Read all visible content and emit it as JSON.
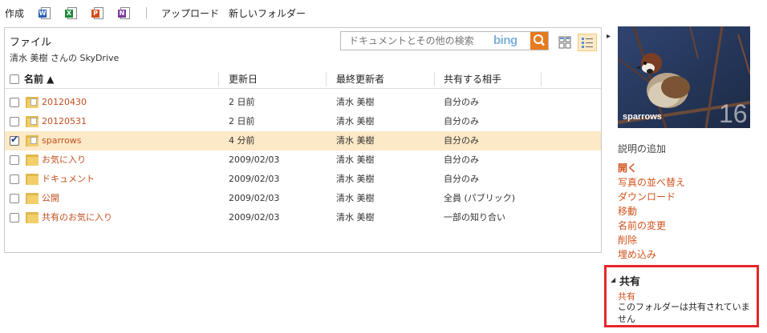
{
  "toolbar": {
    "create_label": "作成",
    "apps": [
      {
        "icon": "word-icon",
        "letter": "W",
        "color": "#2a5fb5"
      },
      {
        "icon": "excel-icon",
        "letter": "X",
        "color": "#1f8a3b"
      },
      {
        "icon": "powerpoint-icon",
        "letter": "P",
        "color": "#d24d1f"
      },
      {
        "icon": "onenote-icon",
        "letter": "N",
        "color": "#7a3a9a"
      }
    ],
    "upload_label": "アップロード",
    "new_folder_label": "新しいフォルダー"
  },
  "panel": {
    "title": "ファイル",
    "subtitle": "清水 美樹 さんの SkyDrive",
    "search_placeholder": "ドキュメントとその他の検索",
    "search_brand": "bing"
  },
  "columns": {
    "name": "名前 ▲",
    "modified": "更新日",
    "modified_by": "最終更新者",
    "shared_with": "共有する相手"
  },
  "rows": [
    {
      "name": "20120430",
      "modified": "2 日前",
      "by": "清水 美樹",
      "shared": "自分のみ",
      "checked": false,
      "type": "photo-folder"
    },
    {
      "name": "20120531",
      "modified": "2 日前",
      "by": "清水 美樹",
      "shared": "自分のみ",
      "checked": false,
      "type": "photo-folder"
    },
    {
      "name": "sparrows",
      "modified": "4 分前",
      "by": "清水 美樹",
      "shared": "自分のみ",
      "checked": true,
      "type": "photo-folder"
    },
    {
      "name": "お気に入り",
      "modified": "2009/02/03",
      "by": "清水 美樹",
      "shared": "自分のみ",
      "checked": false,
      "type": "folder"
    },
    {
      "name": "ドキュメント",
      "modified": "2009/02/03",
      "by": "清水 美樹",
      "shared": "自分のみ",
      "checked": false,
      "type": "folder"
    },
    {
      "name": "公開",
      "modified": "2009/02/03",
      "by": "清水 美樹",
      "shared": "全員 (パブリック)",
      "checked": false,
      "type": "folder"
    },
    {
      "name": "共有のお気に入り",
      "modified": "2009/02/03",
      "by": "清水 美樹",
      "shared": "一部の知り合い",
      "checked": false,
      "type": "folder"
    }
  ],
  "sidebar": {
    "thumbnail_label": "sparrows",
    "thumbnail_count": "16",
    "add_description": "説明の追加",
    "actions": [
      "開く",
      "写真の並べ替え",
      "ダウンロード",
      "移動",
      "名前の変更",
      "削除",
      "埋め込み"
    ],
    "share": {
      "title": "共有",
      "link": "共有",
      "status": "このフォルダーは共有されていません"
    }
  },
  "colors": {
    "accent_link": "#d0531d",
    "selected_row": "#fce9c7",
    "highlight_border": "#e8262a"
  }
}
